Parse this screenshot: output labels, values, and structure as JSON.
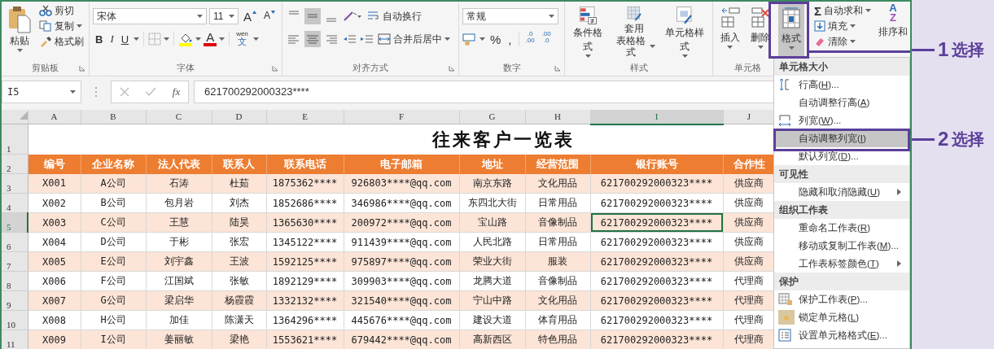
{
  "ribbon": {
    "clipboard": {
      "label": "剪贴板",
      "paste": "粘贴",
      "cut": "剪切",
      "copy": "复制",
      "painter": "格式刷"
    },
    "font": {
      "label": "字体",
      "name": "宋体",
      "size": "11",
      "grow": "A",
      "shrink": "A",
      "bold": "B",
      "italic": "I",
      "underline": "U",
      "font_color": "A",
      "phonetic_top": "wén",
      "phonetic": "文"
    },
    "alignment": {
      "label": "对齐方式",
      "wrap": "自动换行",
      "merge": "合并后居中"
    },
    "number": {
      "label": "数字",
      "format": "常规",
      "percent": "%",
      "comma": ",",
      "decimals": [
        {
          "top": ".0",
          "bottom": ".00"
        },
        {
          "top": ".00",
          "bottom": ".0"
        }
      ]
    },
    "styles": {
      "label": "样式",
      "conditional": "条件格式",
      "table": [
        "套用",
        "表格格式"
      ],
      "cell_styles": "单元格样式"
    },
    "cells": {
      "label": "单元格",
      "insert": "插入",
      "delete": "删除",
      "format": "格式",
      "format_selected": true
    },
    "editing": {
      "autosum_symbol": "Σ",
      "autosum": "自动求和",
      "fill": "填充",
      "clear": "清除",
      "sort_letters": [
        "A",
        "Z"
      ],
      "sort": "排序和"
    }
  },
  "formula_bar": {
    "name_box": "I5",
    "fx": "fx",
    "value": "621700292000323****"
  },
  "sheet": {
    "columns": [
      {
        "letter": "A",
        "selected": false
      },
      {
        "letter": "B",
        "selected": false
      },
      {
        "letter": "C",
        "selected": false
      },
      {
        "letter": "D",
        "selected": false
      },
      {
        "letter": "E",
        "selected": false
      },
      {
        "letter": "F",
        "selected": false
      },
      {
        "letter": "G",
        "selected": false
      },
      {
        "letter": "H",
        "selected": false
      },
      {
        "letter": "I",
        "selected": true
      },
      {
        "letter": "J",
        "selected": false
      }
    ],
    "title": {
      "row": "1",
      "text": "往来客户一览表"
    },
    "header": {
      "row": "2",
      "cells": [
        "编号",
        "企业名称",
        "法人代表",
        "联系人",
        "联系电话",
        "电子邮箱",
        "地址",
        "经营范围",
        "银行账号",
        "合作性"
      ]
    },
    "rows": [
      {
        "row": "3",
        "selected": false,
        "shaded": true,
        "cells": [
          "X001",
          "A公司",
          "石涛",
          "杜茹",
          "1875362****",
          "926803****@qq.com",
          "南京东路",
          "文化用品",
          "621700292000323****",
          "供应商"
        ]
      },
      {
        "row": "4",
        "selected": false,
        "shaded": false,
        "cells": [
          "X002",
          "B公司",
          "包月岩",
          "刘杰",
          "1852686****",
          "346986****@qq.com",
          "东四北大街",
          "日常用品",
          "621700292000323****",
          "供应商"
        ]
      },
      {
        "row": "5",
        "selected": true,
        "shaded": true,
        "cells": [
          "X003",
          "C公司",
          "王慧",
          "陆昊",
          "1365630****",
          "200972****@qq.com",
          "宝山路",
          "音像制品",
          "621700292000323****",
          "供应商"
        ]
      },
      {
        "row": "6",
        "selected": false,
        "shaded": false,
        "cells": [
          "X004",
          "D公司",
          "于彬",
          "张宏",
          "1345122****",
          "911439****@qq.com",
          "人民北路",
          "日常用品",
          "621700292000323****",
          "供应商"
        ]
      },
      {
        "row": "7",
        "selected": false,
        "shaded": true,
        "cells": [
          "X005",
          "E公司",
          "刘宇鑫",
          "王波",
          "1592125****",
          "975897****@qq.com",
          "荣业大街",
          "服装",
          "621700292000323****",
          "供应商"
        ]
      },
      {
        "row": "8",
        "selected": false,
        "shaded": false,
        "cells": [
          "X006",
          "F公司",
          "江国斌",
          "张敏",
          "1892129****",
          "309903****@qq.com",
          "龙腾大道",
          "音像制品",
          "621700292000323****",
          "代理商"
        ]
      },
      {
        "row": "9",
        "selected": false,
        "shaded": true,
        "cells": [
          "X007",
          "G公司",
          "梁启华",
          "杨霞霞",
          "1332132****",
          "321540****@qq.com",
          "宁山中路",
          "文化用品",
          "621700292000323****",
          "代理商"
        ]
      },
      {
        "row": "10",
        "selected": false,
        "shaded": false,
        "cells": [
          "X008",
          "H公司",
          "加佳",
          "陈潇天",
          "1364296****",
          "445676****@qq.com",
          "建设大道",
          "体育用品",
          "621700292000323****",
          "代理商"
        ]
      },
      {
        "row": "11",
        "selected": false,
        "shaded": true,
        "cells": [
          "X009",
          "I公司",
          "姜丽敏",
          "梁艳",
          "1553621****",
          "679442****@qq.com",
          "高新西区",
          "特色用品",
          "621700292000323****",
          "代理商"
        ]
      }
    ]
  },
  "menu": {
    "items": [
      {
        "kind": "header",
        "label": "单元格大小"
      },
      {
        "kind": "row-height",
        "before": "行高(",
        "key": "H",
        "after": ")...",
        "selected": false,
        "submenu": false
      },
      {
        "kind": "plain",
        "before": "自动调整行高(",
        "key": "A",
        "after": ")",
        "selected": false,
        "submenu": false
      },
      {
        "kind": "col-width",
        "before": "列宽(",
        "key": "W",
        "after": ")...",
        "selected": false,
        "submenu": false
      },
      {
        "kind": "plain",
        "before": "自动调整列宽(",
        "key": "I",
        "after": ")",
        "selected": true,
        "submenu": false
      },
      {
        "kind": "plain",
        "before": "默认列宽(",
        "key": "D",
        "after": ")...",
        "selected": false,
        "submenu": false
      },
      {
        "kind": "header",
        "label": "可见性"
      },
      {
        "kind": "plain",
        "before": "隐藏和取消隐藏(",
        "key": "U",
        "after": ")",
        "selected": false,
        "submenu": true
      },
      {
        "kind": "header",
        "label": "组织工作表"
      },
      {
        "kind": "plain",
        "before": "重命名工作表(",
        "key": "R",
        "after": ")",
        "selected": false,
        "submenu": false
      },
      {
        "kind": "plain",
        "before": "移动或复制工作表(",
        "key": "M",
        "after": ")...",
        "selected": false,
        "submenu": false
      },
      {
        "kind": "plain",
        "before": "工作表标签颜色(",
        "key": "T",
        "after": ")",
        "selected": false,
        "submenu": true
      },
      {
        "kind": "header",
        "label": "保护"
      },
      {
        "kind": "protect",
        "before": "保护工作表(",
        "key": "P",
        "after": ")...",
        "selected": false,
        "submenu": false
      },
      {
        "kind": "lock",
        "before": "锁定单元格(",
        "key": "L",
        "after": ")",
        "selected": false,
        "submenu": false
      },
      {
        "kind": "format-cells",
        "before": "设置单元格格式(",
        "key": "E",
        "after": ")...",
        "selected": false,
        "submenu": false
      }
    ]
  },
  "callouts": [
    {
      "number": "1",
      "text": "选择"
    },
    {
      "number": "2",
      "text": "选择"
    }
  ]
}
